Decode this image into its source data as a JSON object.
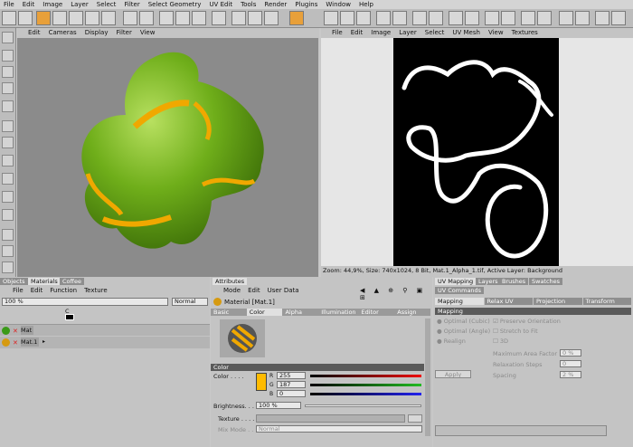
{
  "menu": [
    "File",
    "Edit",
    "Image",
    "Layer",
    "Select",
    "Filter",
    "Select Geometry",
    "UV Edit",
    "Tools",
    "Render",
    "Plugins",
    "Window",
    "Help"
  ],
  "viewport_left": {
    "menu": [
      "Edit",
      "Cameras",
      "Display",
      "Filter",
      "View"
    ]
  },
  "viewport_right": {
    "menu": [
      "File",
      "Edit",
      "Image",
      "Layer",
      "Select",
      "UV Mesh",
      "View",
      "Textures"
    ],
    "status": "Zoom: 44,9%, Size: 740x1024, 8 Bit, Mat.1_Alpha_1.tif, Active Layer: Background"
  },
  "materials_panel": {
    "tabs": [
      "Objects",
      "Materials",
      "Coffee"
    ],
    "menu": [
      "File",
      "Edit",
      "Function",
      "Texture"
    ],
    "percent": "100 %",
    "mode": "Normal",
    "channel_label": "C",
    "rows": [
      {
        "name": "Mat"
      },
      {
        "name": "Mat.1"
      }
    ]
  },
  "attributes_panel": {
    "tab": "Attributes",
    "menu": [
      "Mode",
      "Edit",
      "User Data"
    ],
    "material_title": "Material [Mat.1]",
    "subtabs": [
      "Basic",
      "Color",
      "Alpha",
      "Illumination",
      "Editor",
      "Assign"
    ],
    "section": "Color",
    "color_label": "Color . . . .",
    "r": "255",
    "g": "187",
    "b": "0",
    "swatch": "#ffbb00",
    "brightness_label": "Brightness. . .",
    "brightness": "100 %",
    "texture_label": "Texture . . . .",
    "mixmode_label": "Mix Mode . . .",
    "mixmode": "Normal",
    "channels": {
      "r": "R",
      "g": "G",
      "b": "B"
    }
  },
  "uv_panel": {
    "tabs": [
      "UV Mapping",
      "Layers",
      "Brushes",
      "Swatches"
    ],
    "subtab": "UV Commands",
    "subtabs2": [
      "Mapping",
      "Relax UV",
      "Projection",
      "Transform"
    ],
    "section": "Mapping",
    "radios": [
      "Optimal (Cubic)",
      "Optimal (Angle)",
      "Realign"
    ],
    "checks": [
      "Preserve Orientation",
      "Stretch to Fit",
      "3D"
    ],
    "fields": [
      {
        "label": "Maximum Area Factor",
        "value": "0 %"
      },
      {
        "label": "Relaxation Steps",
        "value": "0"
      },
      {
        "label": "Spacing",
        "value": "2 %"
      }
    ],
    "apply": "Apply"
  },
  "colors": {
    "green": "#6fae1a",
    "orange": "#f0a800",
    "viewport": "#8b8b8b"
  }
}
